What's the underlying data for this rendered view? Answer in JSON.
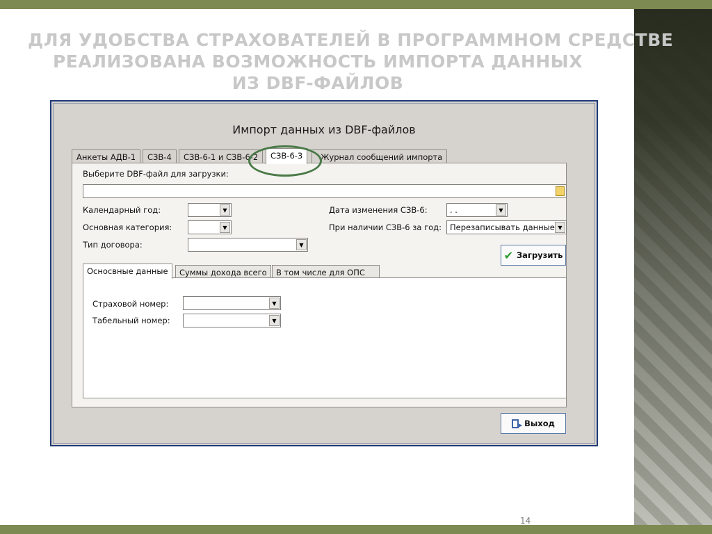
{
  "slide": {
    "title_lines": [
      "Для удобства страхователей в программном средстве",
      "реализована возможность импорта данных",
      "из DBF-файлов"
    ],
    "page_number": "14"
  },
  "dialog": {
    "title": "Импорт данных из DBF-файлов",
    "tabs": [
      "Анкеты АДВ-1",
      "СЗВ-4",
      "СЗВ-6-1 и СЗВ-6-2",
      "СЗВ-6-3",
      "Журнал сообщений импорта"
    ],
    "active_tab": "СЗВ-6-3",
    "file": {
      "label": "Выберите DBF-файл для загрузки:",
      "value": ""
    },
    "calendar_year": {
      "label": "Календарный год:",
      "value": ""
    },
    "main_category": {
      "label": "Основная категория:",
      "value": ""
    },
    "contract_type": {
      "label": "Тип договора:",
      "value": ""
    },
    "change_date": {
      "label": "Дата изменения СЗВ-6:",
      "value": " .  ."
    },
    "if_exists": {
      "label": "При наличии СЗВ-6 за год:",
      "value": "Перезаписывать данные"
    },
    "load_button": "Загрузить",
    "inner_tabs": [
      "Осносвные данные",
      "Суммы дохода всего",
      "В том числе для ОПС"
    ],
    "active_inner_tab": "Осносвные данные",
    "insurance_number": {
      "label": "Страховой номер:",
      "value": ""
    },
    "personnel_number": {
      "label": "Табельный номер:",
      "value": ""
    },
    "exit_button": "Выход"
  },
  "colors": {
    "accent_bars": "#7d8a52",
    "dialog_border": "#1f3a78",
    "highlight_circle": "#4a7a48",
    "check_icon": "#2e9a2e"
  },
  "icons": [
    "folder-icon",
    "dropdown-arrow-icon",
    "checkmark-icon",
    "exit-door-icon"
  ]
}
